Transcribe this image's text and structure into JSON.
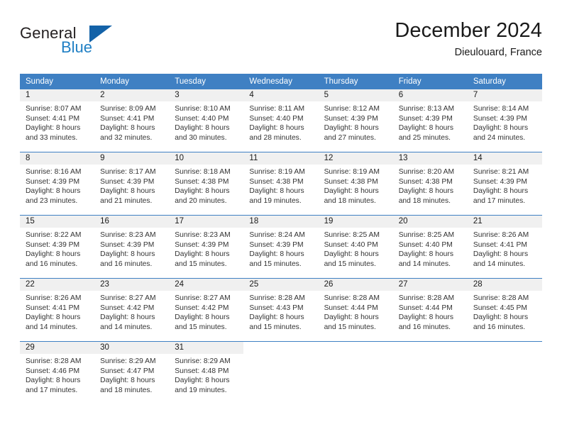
{
  "brand": {
    "name_part1": "General",
    "name_part2": "Blue",
    "triangle_color": "#1362a8",
    "blue_color": "#1f7fc4"
  },
  "header": {
    "title": "December 2024",
    "location": "Dieulouard, France"
  },
  "theme": {
    "header_row_bg": "#3f80c3",
    "daynum_bg": "#f0f0f0",
    "row_divider": "#3f80c3"
  },
  "weekdays": [
    "Sunday",
    "Monday",
    "Tuesday",
    "Wednesday",
    "Thursday",
    "Friday",
    "Saturday"
  ],
  "weeks": [
    [
      {
        "day": "1",
        "sunrise": "Sunrise: 8:07 AM",
        "sunset": "Sunset: 4:41 PM",
        "daylight1": "Daylight: 8 hours",
        "daylight2": "and 33 minutes."
      },
      {
        "day": "2",
        "sunrise": "Sunrise: 8:09 AM",
        "sunset": "Sunset: 4:41 PM",
        "daylight1": "Daylight: 8 hours",
        "daylight2": "and 32 minutes."
      },
      {
        "day": "3",
        "sunrise": "Sunrise: 8:10 AM",
        "sunset": "Sunset: 4:40 PM",
        "daylight1": "Daylight: 8 hours",
        "daylight2": "and 30 minutes."
      },
      {
        "day": "4",
        "sunrise": "Sunrise: 8:11 AM",
        "sunset": "Sunset: 4:40 PM",
        "daylight1": "Daylight: 8 hours",
        "daylight2": "and 28 minutes."
      },
      {
        "day": "5",
        "sunrise": "Sunrise: 8:12 AM",
        "sunset": "Sunset: 4:39 PM",
        "daylight1": "Daylight: 8 hours",
        "daylight2": "and 27 minutes."
      },
      {
        "day": "6",
        "sunrise": "Sunrise: 8:13 AM",
        "sunset": "Sunset: 4:39 PM",
        "daylight1": "Daylight: 8 hours",
        "daylight2": "and 25 minutes."
      },
      {
        "day": "7",
        "sunrise": "Sunrise: 8:14 AM",
        "sunset": "Sunset: 4:39 PM",
        "daylight1": "Daylight: 8 hours",
        "daylight2": "and 24 minutes."
      }
    ],
    [
      {
        "day": "8",
        "sunrise": "Sunrise: 8:16 AM",
        "sunset": "Sunset: 4:39 PM",
        "daylight1": "Daylight: 8 hours",
        "daylight2": "and 23 minutes."
      },
      {
        "day": "9",
        "sunrise": "Sunrise: 8:17 AM",
        "sunset": "Sunset: 4:39 PM",
        "daylight1": "Daylight: 8 hours",
        "daylight2": "and 21 minutes."
      },
      {
        "day": "10",
        "sunrise": "Sunrise: 8:18 AM",
        "sunset": "Sunset: 4:38 PM",
        "daylight1": "Daylight: 8 hours",
        "daylight2": "and 20 minutes."
      },
      {
        "day": "11",
        "sunrise": "Sunrise: 8:19 AM",
        "sunset": "Sunset: 4:38 PM",
        "daylight1": "Daylight: 8 hours",
        "daylight2": "and 19 minutes."
      },
      {
        "day": "12",
        "sunrise": "Sunrise: 8:19 AM",
        "sunset": "Sunset: 4:38 PM",
        "daylight1": "Daylight: 8 hours",
        "daylight2": "and 18 minutes."
      },
      {
        "day": "13",
        "sunrise": "Sunrise: 8:20 AM",
        "sunset": "Sunset: 4:38 PM",
        "daylight1": "Daylight: 8 hours",
        "daylight2": "and 18 minutes."
      },
      {
        "day": "14",
        "sunrise": "Sunrise: 8:21 AM",
        "sunset": "Sunset: 4:39 PM",
        "daylight1": "Daylight: 8 hours",
        "daylight2": "and 17 minutes."
      }
    ],
    [
      {
        "day": "15",
        "sunrise": "Sunrise: 8:22 AM",
        "sunset": "Sunset: 4:39 PM",
        "daylight1": "Daylight: 8 hours",
        "daylight2": "and 16 minutes."
      },
      {
        "day": "16",
        "sunrise": "Sunrise: 8:23 AM",
        "sunset": "Sunset: 4:39 PM",
        "daylight1": "Daylight: 8 hours",
        "daylight2": "and 16 minutes."
      },
      {
        "day": "17",
        "sunrise": "Sunrise: 8:23 AM",
        "sunset": "Sunset: 4:39 PM",
        "daylight1": "Daylight: 8 hours",
        "daylight2": "and 15 minutes."
      },
      {
        "day": "18",
        "sunrise": "Sunrise: 8:24 AM",
        "sunset": "Sunset: 4:39 PM",
        "daylight1": "Daylight: 8 hours",
        "daylight2": "and 15 minutes."
      },
      {
        "day": "19",
        "sunrise": "Sunrise: 8:25 AM",
        "sunset": "Sunset: 4:40 PM",
        "daylight1": "Daylight: 8 hours",
        "daylight2": "and 15 minutes."
      },
      {
        "day": "20",
        "sunrise": "Sunrise: 8:25 AM",
        "sunset": "Sunset: 4:40 PM",
        "daylight1": "Daylight: 8 hours",
        "daylight2": "and 14 minutes."
      },
      {
        "day": "21",
        "sunrise": "Sunrise: 8:26 AM",
        "sunset": "Sunset: 4:41 PM",
        "daylight1": "Daylight: 8 hours",
        "daylight2": "and 14 minutes."
      }
    ],
    [
      {
        "day": "22",
        "sunrise": "Sunrise: 8:26 AM",
        "sunset": "Sunset: 4:41 PM",
        "daylight1": "Daylight: 8 hours",
        "daylight2": "and 14 minutes."
      },
      {
        "day": "23",
        "sunrise": "Sunrise: 8:27 AM",
        "sunset": "Sunset: 4:42 PM",
        "daylight1": "Daylight: 8 hours",
        "daylight2": "and 14 minutes."
      },
      {
        "day": "24",
        "sunrise": "Sunrise: 8:27 AM",
        "sunset": "Sunset: 4:42 PM",
        "daylight1": "Daylight: 8 hours",
        "daylight2": "and 15 minutes."
      },
      {
        "day": "25",
        "sunrise": "Sunrise: 8:28 AM",
        "sunset": "Sunset: 4:43 PM",
        "daylight1": "Daylight: 8 hours",
        "daylight2": "and 15 minutes."
      },
      {
        "day": "26",
        "sunrise": "Sunrise: 8:28 AM",
        "sunset": "Sunset: 4:44 PM",
        "daylight1": "Daylight: 8 hours",
        "daylight2": "and 15 minutes."
      },
      {
        "day": "27",
        "sunrise": "Sunrise: 8:28 AM",
        "sunset": "Sunset: 4:44 PM",
        "daylight1": "Daylight: 8 hours",
        "daylight2": "and 16 minutes."
      },
      {
        "day": "28",
        "sunrise": "Sunrise: 8:28 AM",
        "sunset": "Sunset: 4:45 PM",
        "daylight1": "Daylight: 8 hours",
        "daylight2": "and 16 minutes."
      }
    ],
    [
      {
        "day": "29",
        "sunrise": "Sunrise: 8:28 AM",
        "sunset": "Sunset: 4:46 PM",
        "daylight1": "Daylight: 8 hours",
        "daylight2": "and 17 minutes."
      },
      {
        "day": "30",
        "sunrise": "Sunrise: 8:29 AM",
        "sunset": "Sunset: 4:47 PM",
        "daylight1": "Daylight: 8 hours",
        "daylight2": "and 18 minutes."
      },
      {
        "day": "31",
        "sunrise": "Sunrise: 8:29 AM",
        "sunset": "Sunset: 4:48 PM",
        "daylight1": "Daylight: 8 hours",
        "daylight2": "and 19 minutes."
      },
      {
        "day": "",
        "sunrise": "",
        "sunset": "",
        "daylight1": "",
        "daylight2": ""
      },
      {
        "day": "",
        "sunrise": "",
        "sunset": "",
        "daylight1": "",
        "daylight2": ""
      },
      {
        "day": "",
        "sunrise": "",
        "sunset": "",
        "daylight1": "",
        "daylight2": ""
      },
      {
        "day": "",
        "sunrise": "",
        "sunset": "",
        "daylight1": "",
        "daylight2": ""
      }
    ]
  ]
}
